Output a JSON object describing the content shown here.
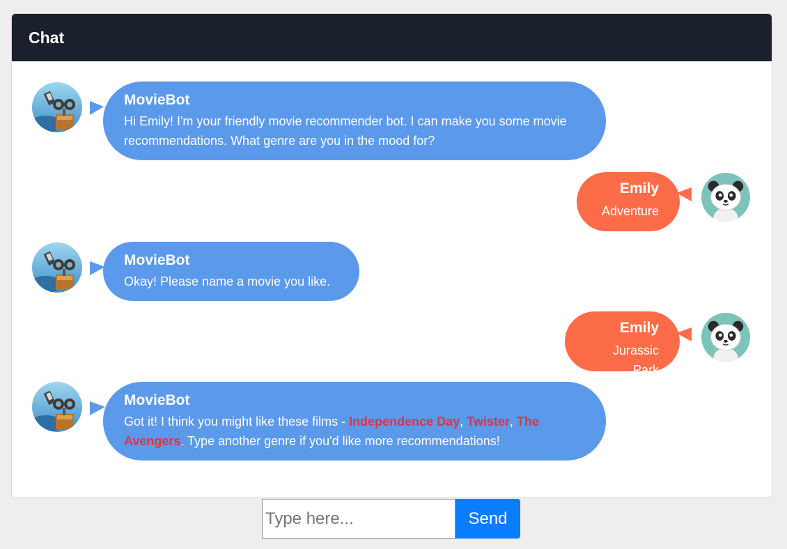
{
  "chat": {
    "title": "Chat",
    "messages": [
      {
        "sender": "MovieBot",
        "role": "bot",
        "text": "Hi Emily! I'm your friendly movie recommender bot. I can make you some movie recommendations. What genre are you in the mood for?"
      },
      {
        "sender": "Emily",
        "role": "user",
        "text": "Adventure"
      },
      {
        "sender": "MovieBot",
        "role": "bot",
        "text": "Okay! Please name a movie you like."
      },
      {
        "sender": "Emily",
        "role": "user",
        "text": "Jurassic Park"
      },
      {
        "sender": "MovieBot",
        "role": "bot",
        "text_before": "Got it! I think you might like these films - ",
        "movies": [
          "Independence Day",
          "Twister",
          "The Avengers"
        ],
        "separator": ", ",
        "text_after": ". Type another genre if you'd like more recommendations!"
      }
    ]
  },
  "composer": {
    "placeholder": "Type here...",
    "value": "",
    "send_label": "Send"
  },
  "colors": {
    "header_bg": "#1a202c",
    "bot_bubble": "#5b99ea",
    "user_bubble": "#fd6c48",
    "movie_highlight": "#dc3545",
    "send_button": "#0a7cff"
  },
  "icons": {
    "bot_avatar": "robot-avatar-icon",
    "user_avatar": "panda-avatar-icon"
  }
}
